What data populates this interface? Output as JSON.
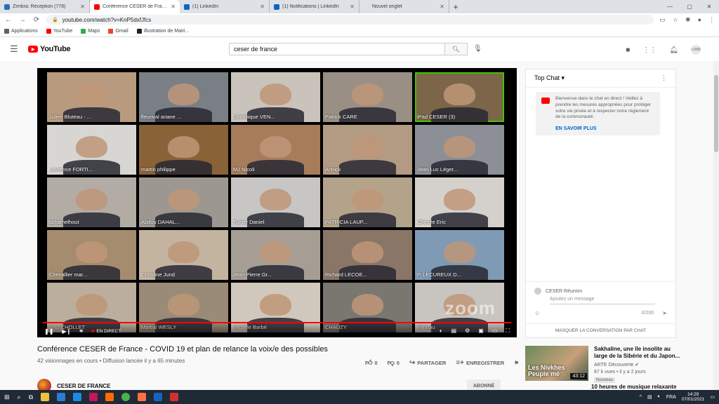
{
  "browser": {
    "tabs": [
      {
        "title": "Zimbra: Réception (778)",
        "color": "#2a6ebb",
        "active": false
      },
      {
        "title": "Conférence CESER de France",
        "color": "#ff0000",
        "active": true
      },
      {
        "title": "(1) LinkedIn",
        "color": "#0a66c2",
        "active": false
      },
      {
        "title": "(1) Notifications | LinkedIn",
        "color": "#0a66c2",
        "active": false
      },
      {
        "title": "Nouvel onglet",
        "color": "#dee1e6",
        "active": false
      }
    ],
    "new_tab": "+",
    "url": "youtube.com/watch?v=KnP5dxfJfcs",
    "bookmarks": [
      {
        "label": "Applications",
        "color": "#5f6368"
      },
      {
        "label": "YouTube",
        "color": "#ff0000"
      },
      {
        "label": "Maps",
        "color": "#34a853"
      },
      {
        "label": "Gmail",
        "color": "#ea4335"
      },
      {
        "label": "Illustration de Mairi...",
        "color": "#202124"
      }
    ]
  },
  "youtube": {
    "logo_text": "YouTube",
    "search_value": "ceser de france",
    "avatar_text": "+1985"
  },
  "video": {
    "participants": [
      {
        "name": "Julien Bluteau - ...",
        "bg": "#b89a7e",
        "highlight": false
      },
      {
        "name": "fleurival ariane ...",
        "bg": "#7a7f86",
        "highlight": false
      },
      {
        "name": "Dominique VEN...",
        "bg": "#c9c3bc",
        "highlight": false
      },
      {
        "name": "Patrick CARE",
        "bg": "#9a8f84",
        "highlight": false
      },
      {
        "name": "iPad CESER (3)",
        "bg": "#7c6548",
        "highlight": true
      },
      {
        "name": "Laurence FORTI...",
        "bg": "#d8d6d3",
        "highlight": false
      },
      {
        "name": "martin philippe",
        "bg": "#8a6238",
        "highlight": false
      },
      {
        "name": "MJ Nicoli",
        "bg": "#a67c5b",
        "highlight": false
      },
      {
        "name": "Annick",
        "bg": "#b39a82",
        "highlight": false
      },
      {
        "name": "Jean-Luc Léger...",
        "bg": "#8c8f96",
        "highlight": false
      },
      {
        "name": "schamelhout",
        "bg": "#b3aca5",
        "highlight": false
      },
      {
        "name": "Abdou DAHAL...",
        "bg": "#9c9790",
        "highlight": false
      },
      {
        "name": "Tunier Daniel",
        "bg": "#c8c6c4",
        "highlight": false
      },
      {
        "name": "PATRICIA LAUP...",
        "bg": "#b3a38a",
        "highlight": false
      },
      {
        "name": "Chevée Eric",
        "bg": "#d4d1cc",
        "highlight": false
      },
      {
        "name": "Chevallier mar...",
        "bg": "#a58c6e",
        "highlight": false
      },
      {
        "name": "Christine Jund",
        "bg": "#c3b4a0",
        "highlight": false
      },
      {
        "name": "Jean-Pierre Gr...",
        "bg": "#a69e94",
        "highlight": false
      },
      {
        "name": "Richard LECOE...",
        "bg": "#8a7667",
        "highlight": false
      },
      {
        "name": "P. LECUREUX D...",
        "bg": "#7f9ab5",
        "highlight": false
      },
      {
        "name": "J.-L. CHOLLET",
        "bg": "#bbae9c",
        "highlight": false
      },
      {
        "name": "Martial WESLY",
        "bg": "#9a8a78",
        "highlight": false
      },
      {
        "name": "Michèle Barbé",
        "bg": "#d0c8bc",
        "highlight": false
      },
      {
        "name": "CHAUZY",
        "bg": "#7a7670",
        "highlight": false
      },
      {
        "name": "Fonnau",
        "bg": "#c8c4bf",
        "highlight": false
      }
    ],
    "live_label": "EN DIRECT",
    "watermark": "zoom",
    "title": "Conférence CESER de France - COVID 19 et plan de relance la voix/e des possibles",
    "meta": "42 visionnages en cours • Diffusion lancée il y a 65 minutes",
    "likes": "0",
    "dislikes": "0",
    "share_label": "PARTAGER",
    "save_label": "ENREGISTRER",
    "channel_name": "CESER DE FRANCE",
    "subscribe_label": "ABONNÉ"
  },
  "chat": {
    "header": "Top Chat",
    "notice": "Bienvenue dans le chat en direct ! Veillez à prendre les mesures appropriées pour protéger votre vie privée et à respecter notre règlement de la communauté.",
    "learn_more": "EN SAVOIR PLUS",
    "user": "CESER Réunion",
    "placeholder": "Ajoutez un message",
    "count": "0/200",
    "hide_label": "MASQUER LA CONVERSATION PAR CHAT"
  },
  "recommendation": {
    "title": "Sakhaline, une île insolite au large de la Sibérie et du Japon...",
    "channel": "ARTE Découverte",
    "views": "87 k vues • il y a 2 jours",
    "badge": "Nouveau",
    "thumb_text": "Les Nivkhes\nPeuple mé",
    "duration": "43:12",
    "next_title": "10 heures de musique relaxante"
  },
  "taskbar": {
    "lang": "FRA",
    "time": "14:29",
    "date": "07/01/2021"
  }
}
